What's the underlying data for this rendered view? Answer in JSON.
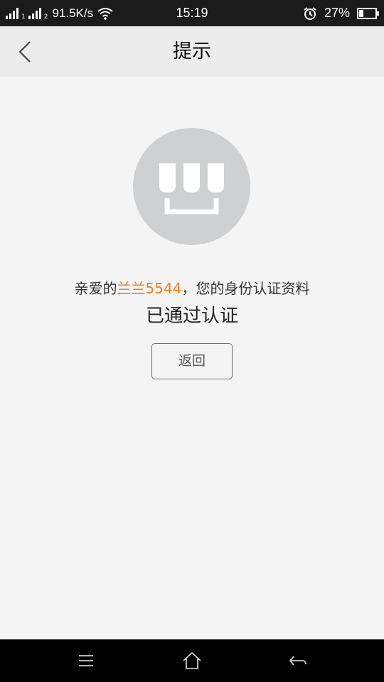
{
  "status_bar": {
    "network_speed": "91.5K/s",
    "sim1_label": "1",
    "sim2_label": "2",
    "time": "15:19",
    "battery_percent": "27%",
    "battery_level": 0.27
  },
  "header": {
    "title": "提示"
  },
  "content": {
    "message_prefix": "亲爱的",
    "username": "兰兰5544",
    "message_suffix": "，您的身份认证资料",
    "status": "已通过认证",
    "return_label": "返回",
    "highlight_color": "#f07f17"
  },
  "nav_bar": {
    "icons": [
      "menu-icon",
      "home-icon",
      "back-icon"
    ]
  }
}
